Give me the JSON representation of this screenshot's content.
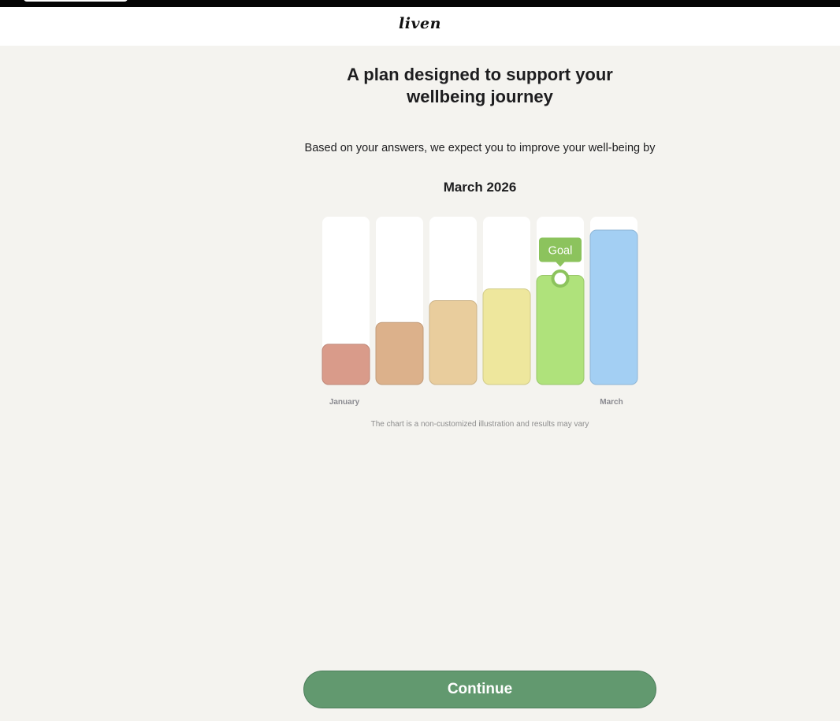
{
  "header": {
    "logo_text": "liven"
  },
  "main": {
    "title": "A plan designed to support your wellbeing journey",
    "subtitle": "Based on your answers, we expect you to improve your well-being by",
    "target_date": "March 2026",
    "disclaimer": "The chart is a non-customized illustration and results may vary"
  },
  "chart_data": {
    "type": "bar",
    "title": "",
    "xlabel": "",
    "ylabel": "",
    "x_tick_labels": [
      "January",
      "March"
    ],
    "values": [
      0.24,
      0.37,
      0.5,
      0.57,
      0.65,
      0.92
    ],
    "ylim": [
      0,
      1
    ],
    "goal_index": 4,
    "goal_label": "Goal",
    "colors": [
      "#d99b8a",
      "#dcb18b",
      "#e9cd9d",
      "#eee79d",
      "#afe27b",
      "#a3cff3"
    ],
    "track_color": "#ffffff",
    "goal_color": "#8cc35d",
    "grid": false,
    "legend": "none"
  },
  "footer": {
    "continue_label": "Continue"
  }
}
